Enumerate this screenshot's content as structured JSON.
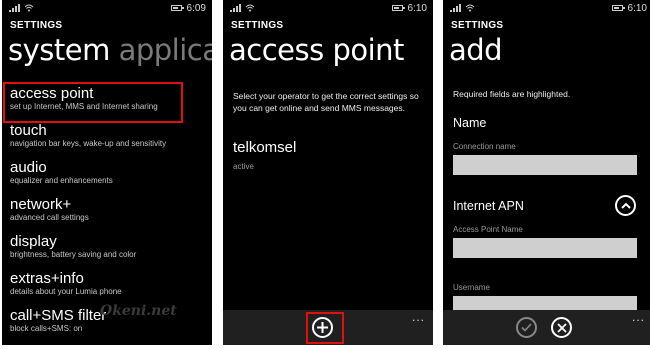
{
  "screens": [
    {
      "status": {
        "time": "6:09"
      },
      "app_title": "SETTINGS",
      "page_title": "system",
      "page_title_next": "applicat",
      "items": [
        {
          "title": "access point",
          "subtitle": "set up Internet, MMS and Internet sharing"
        },
        {
          "title": "touch",
          "subtitle": "navigation bar keys, wake-up and sensitivity"
        },
        {
          "title": "audio",
          "subtitle": "equalizer and enhancements"
        },
        {
          "title": "network+",
          "subtitle": "advanced call settings"
        },
        {
          "title": "display",
          "subtitle": "brightness, battery saving and color"
        },
        {
          "title": "extras+info",
          "subtitle": "details about your Lumia phone"
        },
        {
          "title": "call+SMS filter",
          "subtitle": "block calls+SMS: on"
        }
      ],
      "watermark": "Okeni.net"
    },
    {
      "status": {
        "time": "6:10"
      },
      "app_title": "SETTINGS",
      "page_title": "access point",
      "description": "Select your operator to get the correct settings so you can get online and send MMS messages.",
      "operator": {
        "name": "telkomsel",
        "status": "active"
      },
      "appbar": {
        "add_icon": "plus-icon",
        "more": "..."
      }
    },
    {
      "status": {
        "time": "6:10"
      },
      "app_title": "SETTINGS",
      "page_title": "add",
      "required_note": "Required fields are highlighted.",
      "name_section": "Name",
      "connection_name_label": "Connection name",
      "connection_name_value": "",
      "apn_section": "Internet APN",
      "apn_label": "Access Point Name",
      "apn_value": "",
      "username_label": "Username",
      "username_value": "",
      "appbar": {
        "save_icon": "check-icon",
        "cancel_icon": "close-icon",
        "more": "..."
      }
    }
  ],
  "colors": {
    "highlight": "#e01010",
    "field_bg": "#cfcfcf",
    "background": "#000000"
  }
}
